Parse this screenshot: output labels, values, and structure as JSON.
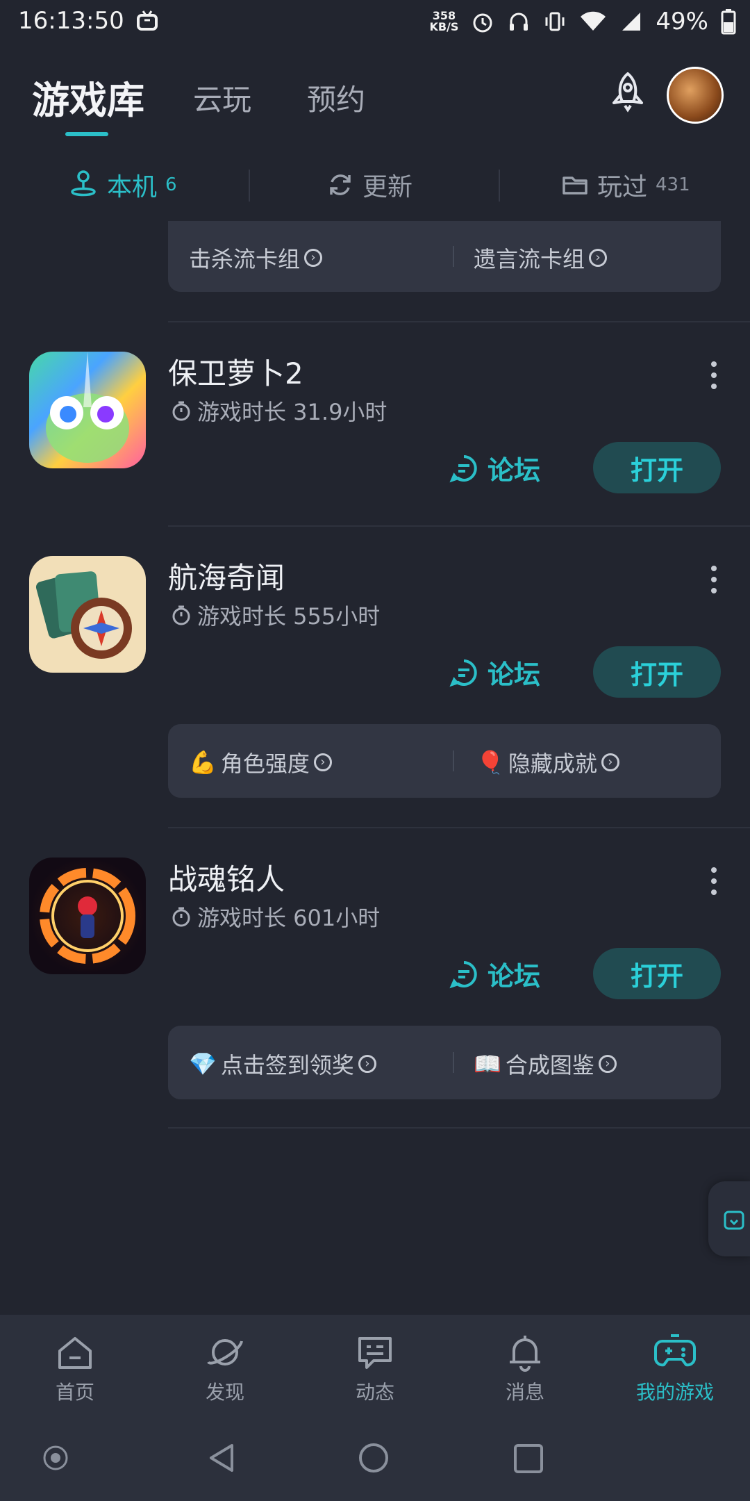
{
  "status_bar": {
    "time": "16:13:50",
    "net_speed_value": "358",
    "net_speed_unit": "KB/S",
    "battery": "49%",
    "icons": [
      "tv-icon",
      "alarm-icon",
      "headphone-icon",
      "vibrate-icon",
      "wifi-icon",
      "signal-icon",
      "battery-icon"
    ]
  },
  "header": {
    "tabs": [
      {
        "label": "游戏库",
        "active": true
      },
      {
        "label": "云玩",
        "active": false
      },
      {
        "label": "预约",
        "active": false
      }
    ]
  },
  "subtabs": [
    {
      "label": "本机",
      "count": "6",
      "icon": "joystick-icon",
      "active": true
    },
    {
      "label": "更新",
      "count": "",
      "icon": "refresh-icon",
      "active": false
    },
    {
      "label": "玩过",
      "count": "431",
      "icon": "folder-icon",
      "active": false
    }
  ],
  "top_card": {
    "items": [
      "击杀流卡组",
      "遗言流卡组"
    ]
  },
  "games": [
    {
      "title": "保卫萝卜2",
      "playtime": "游戏时长 31.9小时",
      "forum_label": "论坛",
      "open_label": "打开",
      "shortcuts": []
    },
    {
      "title": "航海奇闻",
      "playtime": "游戏时长 555小时",
      "forum_label": "论坛",
      "open_label": "打开",
      "shortcuts": [
        {
          "emoji": "💪",
          "label": "角色强度"
        },
        {
          "emoji": "🎈",
          "label": "隐藏成就"
        }
      ]
    },
    {
      "title": "战魂铭人",
      "playtime": "游戏时长 601小时",
      "forum_label": "论坛",
      "open_label": "打开",
      "shortcuts": [
        {
          "emoji": "💎",
          "label": "点击签到领奖"
        },
        {
          "emoji": "📖",
          "label": "合成图鉴"
        }
      ]
    }
  ],
  "bottom_nav": [
    {
      "label": "首页",
      "icon": "home-icon",
      "active": false
    },
    {
      "label": "发现",
      "icon": "planet-icon",
      "active": false
    },
    {
      "label": "动态",
      "icon": "chat-icon",
      "active": false
    },
    {
      "label": "消息",
      "icon": "bell-icon",
      "active": false
    },
    {
      "label": "我的游戏",
      "icon": "gamepad-icon",
      "active": true
    }
  ],
  "colors": {
    "accent": "#2bbfc8",
    "background": "#22252f",
    "card": "#323643"
  }
}
